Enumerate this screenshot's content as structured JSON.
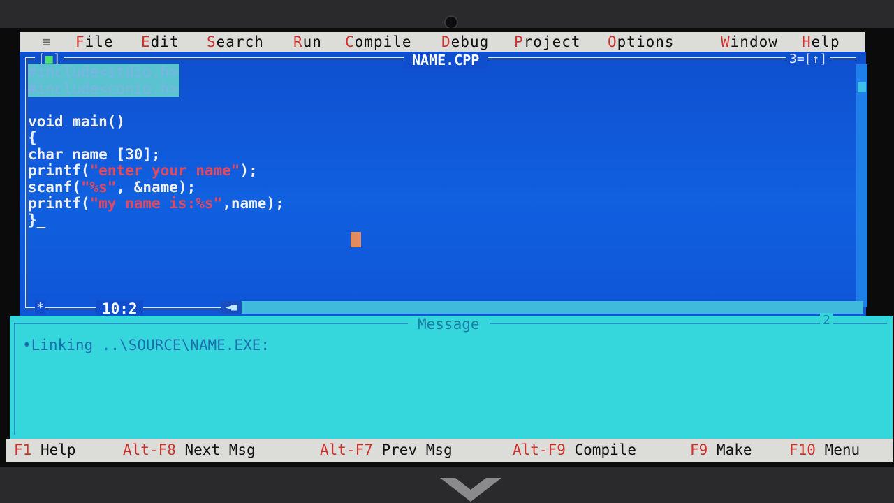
{
  "menu": {
    "system_icon": "≡",
    "items": [
      {
        "hot": "F",
        "rest": "ile"
      },
      {
        "hot": "E",
        "rest": "dit"
      },
      {
        "hot": "S",
        "rest": "earch"
      },
      {
        "hot": "R",
        "rest": "un"
      },
      {
        "hot": "C",
        "rest": "ompile"
      },
      {
        "hot": "D",
        "rest": "ebug"
      },
      {
        "hot": "P",
        "rest": "roject"
      },
      {
        "hot": "O",
        "rest": "ptions"
      },
      {
        "hot": "W",
        "rest": "indow"
      },
      {
        "hot": "H",
        "rest": "elp"
      }
    ]
  },
  "editor": {
    "close_box_left": "[",
    "close_box_mark": "■",
    "close_box_right": "]",
    "title": "NAME.CPP",
    "window_number": "3=[↑]",
    "code": {
      "include1": "#include<stdio.h>",
      "include2": "#include<conio.h>",
      "main_sig": "void main()",
      "open_brace": "{",
      "decl": "char name [30];",
      "printf1_a": "printf(",
      "printf1_str": "\"enter your name\"",
      "printf1_b": ");",
      "scanf_a": "scanf(",
      "scanf_str": "\"%s\"",
      "scanf_b": ", &name);",
      "printf2_a": "printf(",
      "printf2_str": "\"my name is:%s\"",
      "printf2_b": ",name);",
      "close_brace": "}_"
    },
    "status_marker": "*",
    "cursor_position": "10:2",
    "hscroll_arrow": "◄■"
  },
  "message_window": {
    "title": "Message",
    "window_number": "2",
    "line": "•Linking ..\\SOURCE\\NAME.EXE:"
  },
  "fkeys": [
    {
      "key": "F1",
      "label": "Help"
    },
    {
      "key": "Alt-F8",
      "label": "Next Msg"
    },
    {
      "key": "Alt-F7",
      "label": "Prev Msg"
    },
    {
      "key": "Alt-F9",
      "label": "Compile"
    },
    {
      "key": "F9",
      "label": "Make"
    },
    {
      "key": "F10",
      "label": "Menu"
    }
  ],
  "colors": {
    "editor_bg": "#0f4fce",
    "string_red": "#e2485e",
    "hotkey_red": "#d0312d",
    "message_bg": "#35d6dc",
    "menu_bg": "#dcdcd8"
  }
}
